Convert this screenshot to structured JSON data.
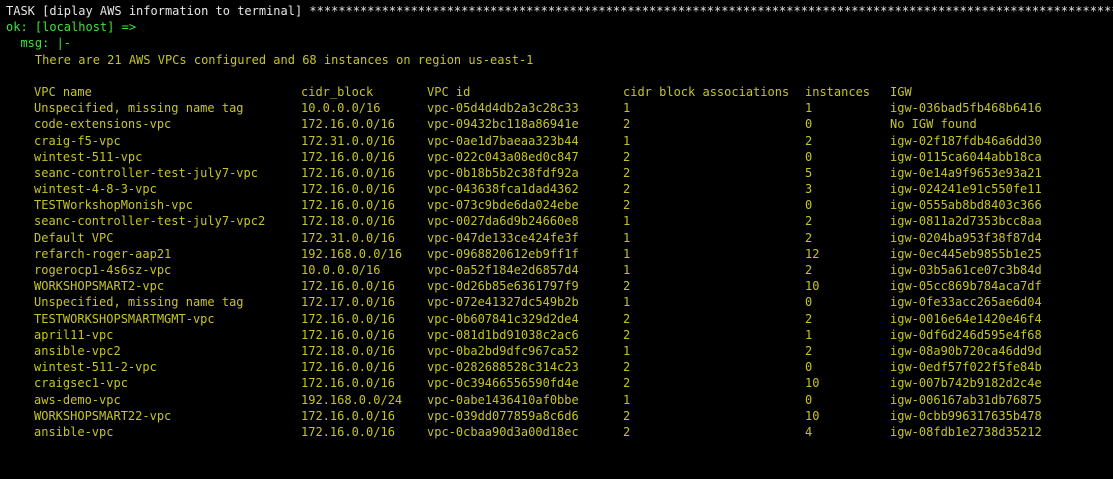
{
  "terminal": {
    "task_line": "TASK [diplay AWS information to terminal] ****************************************************************************************************************",
    "ok_line": "ok: [localhost] =>",
    "msg_line": "  msg: |-",
    "summary_line": "    There are 21 AWS VPCs configured and 68 instances on region us-east-1"
  },
  "table": {
    "headers": [
      "VPC name",
      "cidr_block",
      "VPC id",
      "cidr block associations",
      "instances",
      "IGW"
    ],
    "rows": [
      [
        "Unspecified, missing name tag",
        "10.0.0.0/16",
        "vpc-05d4d4db2a3c28c33",
        "1",
        "1",
        "igw-036bad5fb468b6416"
      ],
      [
        "code-extensions-vpc",
        "172.16.0.0/16",
        "vpc-09432bc118a86941e",
        "2",
        "0",
        "No IGW found"
      ],
      [
        "craig-f5-vpc",
        "172.31.0.0/16",
        "vpc-0ae1d7baeaa323b44",
        "1",
        "2",
        "igw-02f187fdb46a6dd30"
      ],
      [
        "wintest-511-vpc",
        "172.16.0.0/16",
        "vpc-022c043a08ed0c847",
        "2",
        "0",
        "igw-0115ca6044abb18ca"
      ],
      [
        "seanc-controller-test-july7-vpc",
        "172.16.0.0/16",
        "vpc-0b18b5b2c38fdf92a",
        "2",
        "5",
        "igw-0e14a9f9653e93a21"
      ],
      [
        "wintest-4-8-3-vpc",
        "172.16.0.0/16",
        "vpc-043638fca1dad4362",
        "2",
        "3",
        "igw-024241e91c550fe11"
      ],
      [
        "TESTWorkshopMonish-vpc",
        "172.16.0.0/16",
        "vpc-073c9bde6da024ebe",
        "2",
        "0",
        "igw-0555ab8bd8403c366"
      ],
      [
        "seanc-controller-test-july7-vpc2",
        "172.18.0.0/16",
        "vpc-0027da6d9b24660e8",
        "1",
        "2",
        "igw-0811a2d7353bcc8aa"
      ],
      [
        "Default VPC",
        "172.31.0.0/16",
        "vpc-047de133ce424fe3f",
        "1",
        "2",
        "igw-0204ba953f38f87d4"
      ],
      [
        "refarch-roger-aap21",
        "192.168.0.0/16",
        "vpc-0968820612eb9ff1f",
        "1",
        "12",
        "igw-0ec445eb9855b1e25"
      ],
      [
        "rogerocp1-4s6sz-vpc",
        "10.0.0.0/16",
        "vpc-0a52f184e2d6857d4",
        "1",
        "2",
        "igw-03b5a61ce07c3b84d"
      ],
      [
        "WORKSHOPSMART2-vpc",
        "172.16.0.0/16",
        "vpc-0d26b85e6361797f9",
        "2",
        "10",
        "igw-05cc869b784aca7df"
      ],
      [
        "Unspecified, missing name tag",
        "172.17.0.0/16",
        "vpc-072e41327dc549b2b",
        "1",
        "0",
        "igw-0fe33acc265ae6d04"
      ],
      [
        "TESTWORKSHOPSMARTMGMT-vpc",
        "172.16.0.0/16",
        "vpc-0b607841c329d2de4",
        "2",
        "2",
        "igw-0016e64e1420e46f4"
      ],
      [
        "april11-vpc",
        "172.16.0.0/16",
        "vpc-081d1bd91038c2ac6",
        "2",
        "1",
        "igw-0df6d246d595e4f68"
      ],
      [
        "ansible-vpc2",
        "172.18.0.0/16",
        "vpc-0ba2bd9dfc967ca52",
        "1",
        "2",
        "igw-08a90b720ca46dd9d"
      ],
      [
        "wintest-511-2-vpc",
        "172.16.0.0/16",
        "vpc-0282688528c314c23",
        "2",
        "0",
        "igw-0edf57f022f5fe84b"
      ],
      [
        "craigsec1-vpc",
        "172.16.0.0/16",
        "vpc-0c39466556590fd4e",
        "2",
        "10",
        "igw-007b742b9182d2c4e"
      ],
      [
        "aws-demo-vpc",
        "192.168.0.0/24",
        "vpc-0abe1436410af0bbe",
        "1",
        "0",
        "igw-006167ab31db76875"
      ],
      [
        "WORKSHOPSMART22-vpc",
        "172.16.0.0/16",
        "vpc-039dd077859a8c6d6",
        "2",
        "10",
        "igw-0cbb996317635b478"
      ],
      [
        "ansible-vpc",
        "172.16.0.0/16",
        "vpc-0cbaa90d3a00d18ec",
        "2",
        "4",
        "igw-08fdb1e2738d35212"
      ]
    ]
  },
  "colors": {
    "background": "#000000",
    "task_text": "#e6e6e6",
    "ok_green": "#39e639",
    "table_olive": "#c5c524"
  }
}
